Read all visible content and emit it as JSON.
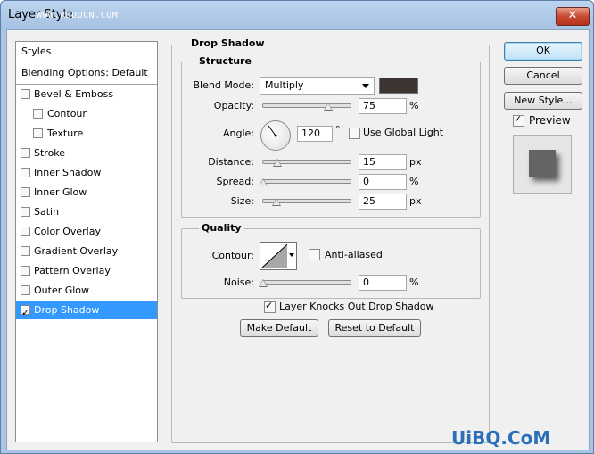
{
  "window": {
    "title": "Layer Style",
    "watermark": "WWW.REDOCN.COM",
    "close_glyph": "✕"
  },
  "sidebar": {
    "header": "Styles",
    "blending": "Blending Options: Default",
    "items": [
      {
        "label": "Bevel & Emboss",
        "checked": false,
        "sub": false
      },
      {
        "label": "Contour",
        "checked": false,
        "sub": true
      },
      {
        "label": "Texture",
        "checked": false,
        "sub": true
      },
      {
        "label": "Stroke",
        "checked": false,
        "sub": false
      },
      {
        "label": "Inner Shadow",
        "checked": false,
        "sub": false
      },
      {
        "label": "Inner Glow",
        "checked": false,
        "sub": false
      },
      {
        "label": "Satin",
        "checked": false,
        "sub": false
      },
      {
        "label": "Color Overlay",
        "checked": false,
        "sub": false
      },
      {
        "label": "Gradient Overlay",
        "checked": false,
        "sub": false
      },
      {
        "label": "Pattern Overlay",
        "checked": false,
        "sub": false
      },
      {
        "label": "Outer Glow",
        "checked": false,
        "sub": false
      },
      {
        "label": "Drop Shadow",
        "checked": true,
        "sub": false
      }
    ]
  },
  "panel": {
    "title": "Drop Shadow",
    "structure": {
      "label": "Structure",
      "blend_mode_label": "Blend Mode:",
      "blend_mode_value": "Multiply",
      "shadow_color": "#3b3431",
      "opacity_label": "Opacity:",
      "opacity_value": "75",
      "opacity_unit": "%",
      "opacity_level": 0.75,
      "angle_label": "Angle:",
      "angle_value": "120",
      "angle_unit": "°",
      "global_light_label": "Use Global Light",
      "distance_label": "Distance:",
      "distance_value": "15",
      "distance_unit": "px",
      "spread_label": "Spread:",
      "spread_value": "0",
      "spread_unit": "%",
      "size_label": "Size:",
      "size_value": "25",
      "size_unit": "px"
    },
    "quality": {
      "label": "Quality",
      "contour_label": "Contour:",
      "anti_aliased_label": "Anti-aliased",
      "noise_label": "Noise:",
      "noise_value": "0",
      "noise_unit": "%"
    },
    "knockout_label": "Layer Knocks Out Drop Shadow",
    "make_default": "Make Default",
    "reset_default": "Reset to Default"
  },
  "buttons": {
    "ok": "OK",
    "cancel": "Cancel",
    "new_style": "New Style...",
    "preview": "Preview"
  },
  "footer_watermark": "UiBQ.CoM"
}
